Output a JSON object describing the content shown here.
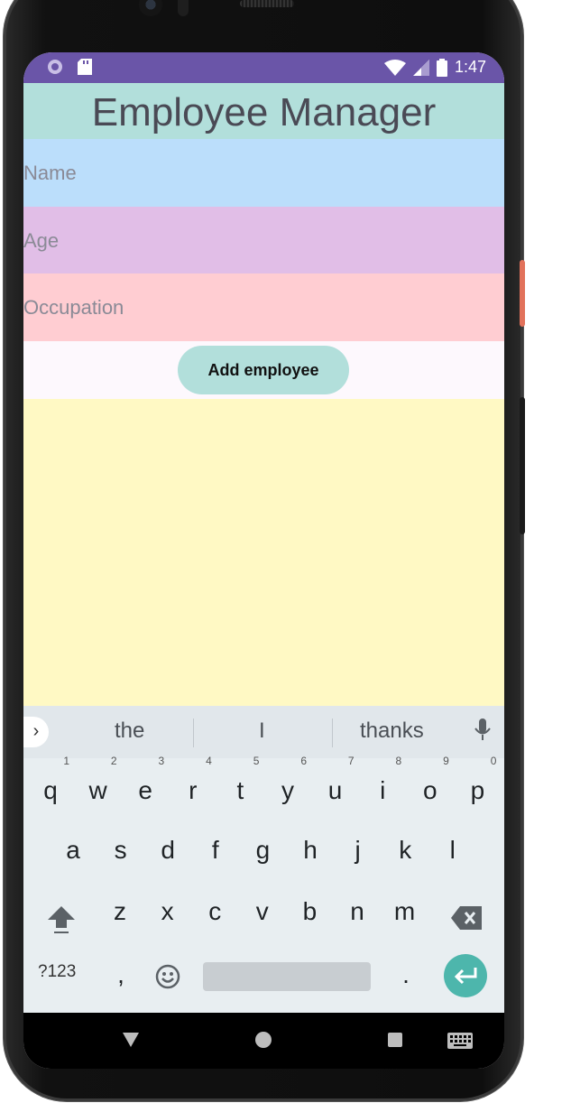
{
  "status_bar": {
    "time": "1:47"
  },
  "app": {
    "title": "Employee Manager",
    "fields": {
      "name_placeholder": "Name",
      "age_placeholder": "Age",
      "occupation_placeholder": "Occupation"
    },
    "add_button_label": "Add employee"
  },
  "keyboard": {
    "suggestions": [
      "the",
      "I",
      "thanks"
    ],
    "row1": [
      {
        "key": "q",
        "hint": "1"
      },
      {
        "key": "w",
        "hint": "2"
      },
      {
        "key": "e",
        "hint": "3"
      },
      {
        "key": "r",
        "hint": "4"
      },
      {
        "key": "t",
        "hint": "5"
      },
      {
        "key": "y",
        "hint": "6"
      },
      {
        "key": "u",
        "hint": "7"
      },
      {
        "key": "i",
        "hint": "8"
      },
      {
        "key": "o",
        "hint": "9"
      },
      {
        "key": "p",
        "hint": "0"
      }
    ],
    "row2": [
      "a",
      "s",
      "d",
      "f",
      "g",
      "h",
      "j",
      "k",
      "l"
    ],
    "row3": [
      "z",
      "x",
      "c",
      "v",
      "b",
      "n",
      "m"
    ],
    "symbols_label": "?123",
    "comma": ",",
    "period": "."
  },
  "colors": {
    "status_bar": "#6a55a8",
    "title_bg": "#b2dfdb",
    "name_bg": "#bbdefb",
    "age_bg": "#e1bee7",
    "occupation_bg": "#ffcdd2",
    "list_bg": "#fff9c4",
    "button_bg": "#b2dfdb",
    "enter_key": "#4db6ac"
  }
}
